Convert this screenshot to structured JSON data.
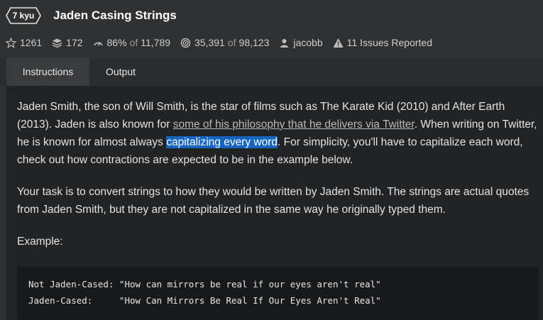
{
  "kata": {
    "rank": "7 kyu",
    "title": "Jaden Casing Strings"
  },
  "stats": {
    "stars": "1261",
    "collections": "172",
    "satisfaction": "86%",
    "satisfaction_of": "of",
    "satisfaction_votes": "11,789",
    "completed": "35,391",
    "completed_of": "of",
    "attempts": "98,123",
    "author": "jacobb",
    "issues": "11 Issues Reported"
  },
  "tabs": [
    {
      "label": "Instructions"
    },
    {
      "label": "Output"
    }
  ],
  "description": {
    "p1_a": "Jaden Smith, the son of Will Smith, is the star of films such as The Karate Kid (2010) and After Earth (2013). Jaden is also known for ",
    "p1_link": "some of his philosophy that he delivers via Twitter",
    "p1_b": ". When writing on Twitter, he is known for almost always ",
    "p1_highlight": "capitalizing every word",
    "p1_c": ". For simplicity, you'll have to capitalize each word, check out how contractions are expected to be in the example below.",
    "p2": "Your task is to convert strings to how they would be written by Jaden Smith. The strings are actual quotes from Jaden Smith, but they are not capitalized in the same way he originally typed them.",
    "p3": "Example:"
  },
  "example": {
    "line1": "Not Jaden-Cased: \"How can mirrors be real if our eyes aren't real\"",
    "line2": "Jaden-Cased:     \"How Can Mirrors Be Real If Our Eyes Aren't Real\""
  },
  "colors": {
    "background": "#303133",
    "panel": "#222325",
    "code_background": "#18191b",
    "highlight": "#1565c0"
  },
  "icons": [
    "kyu-badge-icon",
    "star-icon",
    "collection-stack-icon",
    "satisfaction-gauge-icon",
    "target-icon",
    "user-icon",
    "warning-icon"
  ]
}
